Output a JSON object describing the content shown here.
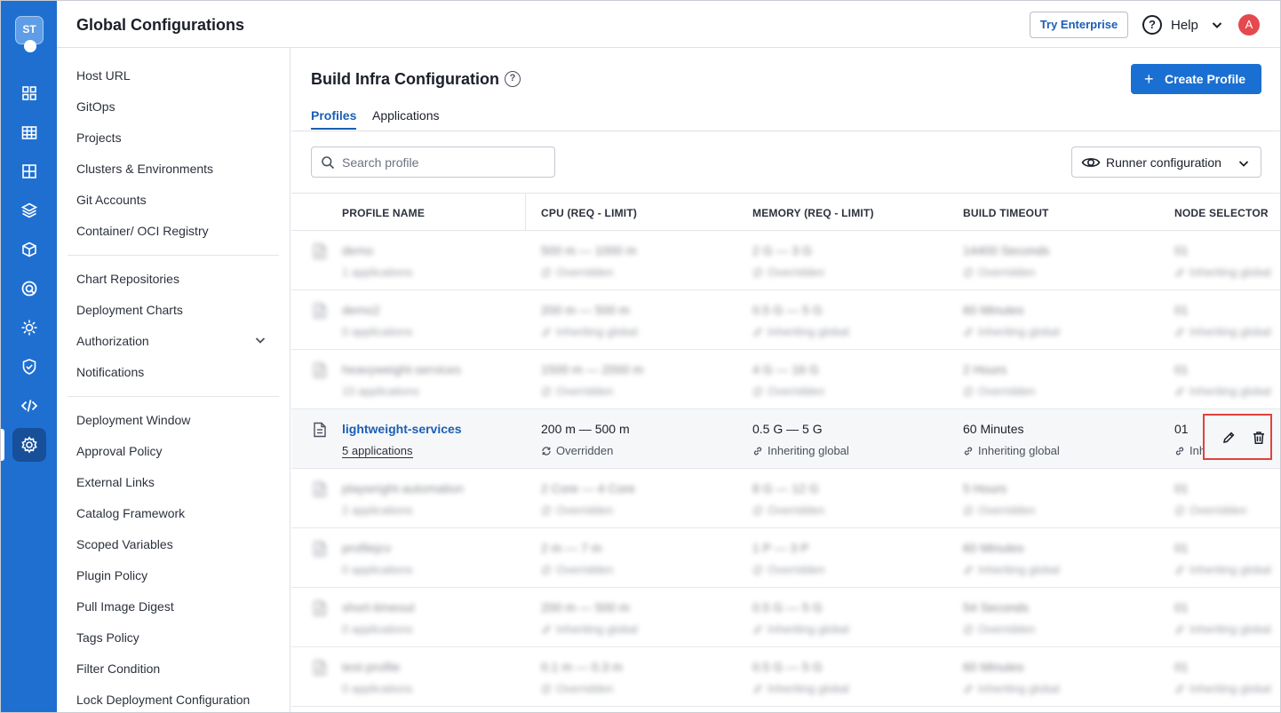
{
  "rail": {
    "logo_text": "ST",
    "items": [
      "home-icon",
      "dashboard-grid-icon",
      "table-icon",
      "layers-icon",
      "cube-icon",
      "target-icon",
      "gear-sun-icon",
      "shield-check-icon",
      "code-icon",
      "settings-icon"
    ],
    "active_index": 9
  },
  "topbar": {
    "title": "Global Configurations",
    "try_enterprise": "Try Enterprise",
    "help": "Help",
    "avatar_initial": "A"
  },
  "settings_nav": {
    "group1": [
      "Host URL",
      "GitOps",
      "Projects",
      "Clusters & Environments",
      "Git Accounts",
      "Container/ OCI Registry"
    ],
    "group2": [
      "Chart Repositories",
      "Deployment Charts",
      "Authorization",
      "Notifications"
    ],
    "group3": [
      "Deployment Window",
      "Approval Policy",
      "External Links",
      "Catalog Framework",
      "Scoped Variables",
      "Plugin Policy",
      "Pull Image Digest",
      "Tags Policy",
      "Filter Condition",
      "Lock Deployment Configuration"
    ]
  },
  "main": {
    "title": "Build Infra Configuration",
    "create_button": "Create Profile",
    "tabs": [
      "Profiles",
      "Applications"
    ],
    "search_placeholder": "Search profile",
    "runner_label": "Runner configuration"
  },
  "table": {
    "headers": [
      "PROFILE NAME",
      "CPU (REQ - LIMIT)",
      "MEMORY (REQ - LIMIT)",
      "BUILD TIMEOUT",
      "NODE SELECTOR"
    ],
    "rows": [
      {
        "name": "demo",
        "apps": "1 applications",
        "cpu": "500 m — 1000 m",
        "cpu_sub": "Overridden",
        "mem": "2 G — 3 G",
        "mem_sub": "Overridden",
        "timeout": "14400 Seconds",
        "timeout_sub": "Overridden",
        "node": "01",
        "node_sub": "Inheriting global"
      },
      {
        "name": "demo2",
        "apps": "0 applications",
        "cpu": "200 m — 500 m",
        "cpu_sub": "Inheriting global",
        "mem": "0.5 G — 5 G",
        "mem_sub": "Inheriting global",
        "timeout": "60 Minutes",
        "timeout_sub": "Inheriting global",
        "node": "01",
        "node_sub": "Inheriting global"
      },
      {
        "name": "heavyweight-services",
        "apps": "10 applications",
        "cpu": "1500 m — 2000 m",
        "cpu_sub": "Overridden",
        "mem": "4 G — 16 G",
        "mem_sub": "Overridden",
        "timeout": "2 Hours",
        "timeout_sub": "Overridden",
        "node": "01",
        "node_sub": "Inheriting global"
      },
      {
        "name": "lightweight-services",
        "apps": "5 applications",
        "cpu": "200 m — 500 m",
        "cpu_sub": "Overridden",
        "mem": "0.5 G — 5 G",
        "mem_sub": "Inheriting global",
        "timeout": "60 Minutes",
        "timeout_sub": "Inheriting global",
        "node": "01",
        "node_sub": "Inh"
      },
      {
        "name": "playwright-automation",
        "apps": "2 applications",
        "cpu": "2 Core — 4 Core",
        "cpu_sub": "Overridden",
        "mem": "8 G — 12 G",
        "mem_sub": "Overridden",
        "timeout": "5 Hours",
        "timeout_sub": "Overridden",
        "node": "01",
        "node_sub": "Overridden"
      },
      {
        "name": "profilejcv",
        "apps": "0 applications",
        "cpu": "2 m — 7 m",
        "cpu_sub": "Overridden",
        "mem": "1 P — 3 P",
        "mem_sub": "Overridden",
        "timeout": "60 Minutes",
        "timeout_sub": "Inheriting global",
        "node": "01",
        "node_sub": "Inheriting global"
      },
      {
        "name": "short-timeout",
        "apps": "0 applications",
        "cpu": "200 m — 500 m",
        "cpu_sub": "Inheriting global",
        "mem": "0.5 G — 5 G",
        "mem_sub": "Inheriting global",
        "timeout": "54 Seconds",
        "timeout_sub": "Overridden",
        "node": "01",
        "node_sub": "Inheriting global"
      },
      {
        "name": "test-profile",
        "apps": "0 applications",
        "cpu": "0.1 m — 0.3 m",
        "cpu_sub": "Overridden",
        "mem": "0.5 G — 5 G",
        "mem_sub": "Inheriting global",
        "timeout": "60 Minutes",
        "timeout_sub": "Inheriting global",
        "node": "01",
        "node_sub": "Inheriting global"
      }
    ],
    "focus_row": 3
  },
  "colors": {
    "primary": "#1f6fd1",
    "link": "#1a5fb4",
    "highlight_border": "#e0433b"
  }
}
